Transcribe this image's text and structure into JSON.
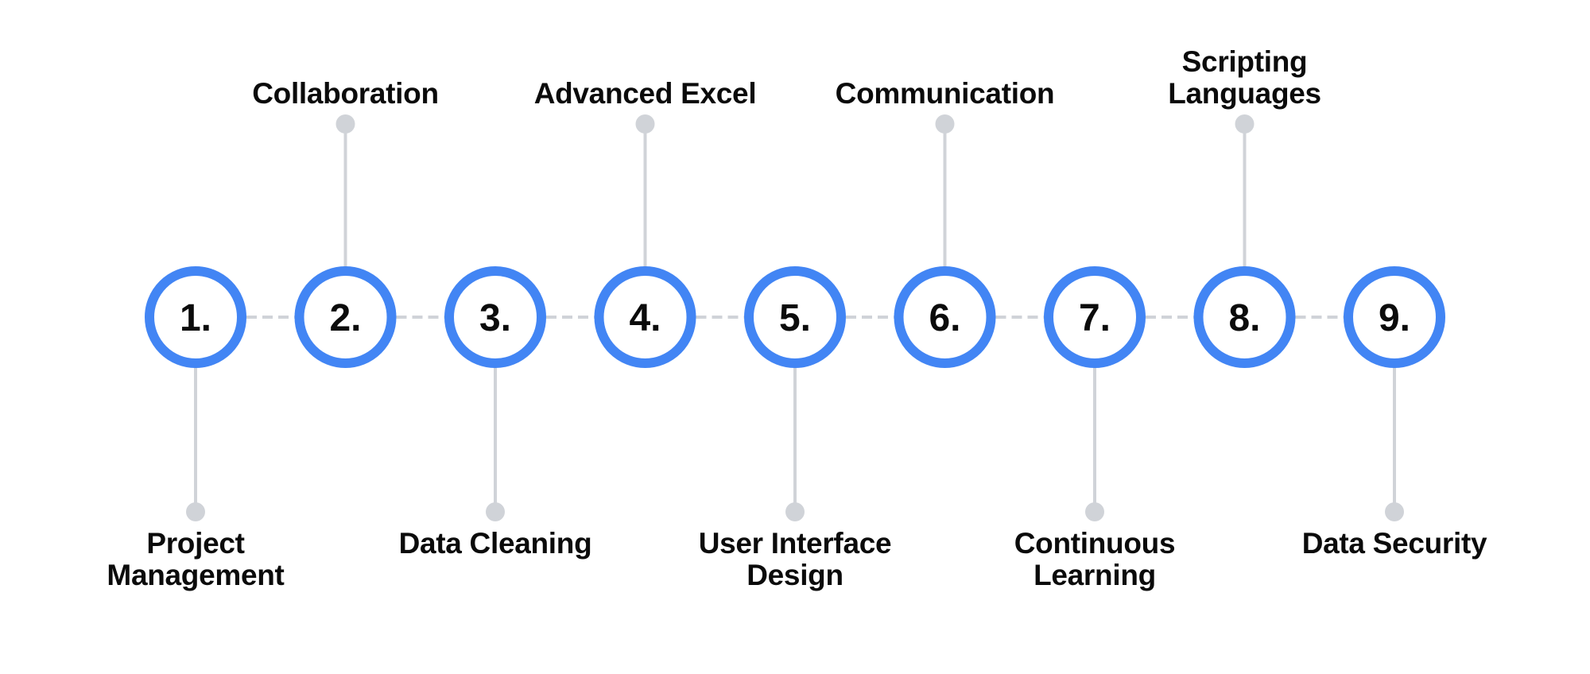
{
  "diagram": {
    "type": "numbered-timeline",
    "colors": {
      "circle_stroke": "#4285f4",
      "connector": "#d0d3d8",
      "text": "#0b0b0b",
      "background": "#ffffff"
    },
    "steps": [
      {
        "number": "1.",
        "label": "Project Management",
        "lines": [
          "Project",
          "Management"
        ],
        "side": "bottom"
      },
      {
        "number": "2.",
        "label": "Collaboration",
        "lines": [
          "Collaboration"
        ],
        "side": "top"
      },
      {
        "number": "3.",
        "label": "Data Cleaning",
        "lines": [
          "Data Cleaning"
        ],
        "side": "bottom"
      },
      {
        "number": "4.",
        "label": "Advanced Excel",
        "lines": [
          "Advanced Excel"
        ],
        "side": "top"
      },
      {
        "number": "5.",
        "label": "User Interface Design",
        "lines": [
          "User Interface",
          "Design"
        ],
        "side": "bottom"
      },
      {
        "number": "6.",
        "label": "Communication",
        "lines": [
          "Communication"
        ],
        "side": "top"
      },
      {
        "number": "7.",
        "label": "Continuous Learning",
        "lines": [
          "Continuous",
          "Learning"
        ],
        "side": "bottom"
      },
      {
        "number": "8.",
        "label": "Scripting Languages",
        "lines": [
          "Scripting",
          "Languages"
        ],
        "side": "top"
      },
      {
        "number": "9.",
        "label": "Data Security",
        "lines": [
          "Data Security"
        ],
        "side": "bottom"
      }
    ]
  }
}
